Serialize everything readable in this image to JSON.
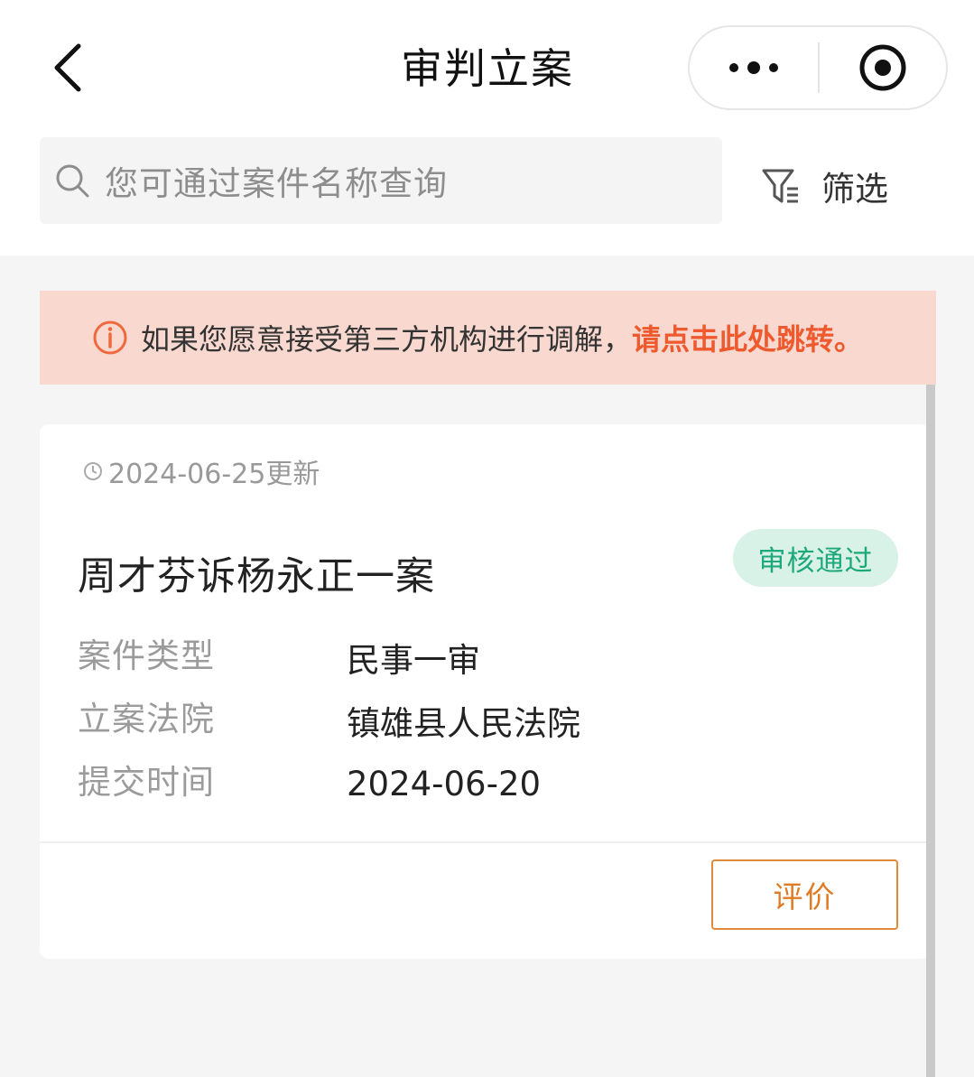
{
  "header": {
    "title": "审判立案",
    "back_icon": "chevron-left-icon",
    "more_icon": "more-dots-icon",
    "close_icon": "target-close-icon"
  },
  "search": {
    "placeholder": "您可通过案件名称查询",
    "icon": "search-icon"
  },
  "filter": {
    "label": "筛选",
    "icon": "filter-icon"
  },
  "notice": {
    "icon": "info-circle-icon",
    "text": "如果您愿意接受第三方机构进行调解，",
    "link": "请点击此处跳转。",
    "background": "#f9d8d0",
    "link_color": "#ee5a2e"
  },
  "case_card": {
    "updated": "2024-06-25更新",
    "title": "周才芬诉杨永正一案",
    "status": "审核通过",
    "status_color": "#1fa87c",
    "fields": [
      {
        "label": "案件类型",
        "value": "民事一审"
      },
      {
        "label": "立案法院",
        "value": "镇雄县人民法院"
      },
      {
        "label": "提交时间",
        "value": "2024-06-20"
      }
    ],
    "action_label": "评价",
    "action_color": "#e07b25"
  }
}
